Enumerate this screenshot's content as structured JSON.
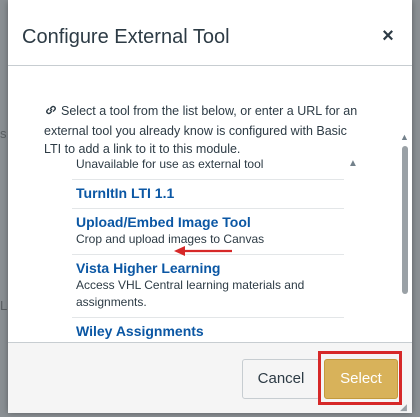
{
  "dialog": {
    "title": "Configure External Tool",
    "close_glyph": "×"
  },
  "intro_text": "Select a tool from the list below, or enter a URL for an external tool you already know is configured with Basic LTI to add a link to it to this module.",
  "tools": [
    {
      "name": "",
      "description": "Unavailable for use as external tool"
    },
    {
      "name": "TurnItIn LTI 1.1",
      "description": ""
    },
    {
      "name": "Upload/Embed Image Tool",
      "description": "Crop and upload images to Canvas"
    },
    {
      "name": "Vista Higher Learning",
      "description": "Access VHL Central learning materials and assignments."
    },
    {
      "name": "Wiley Assignments",
      "description": ""
    }
  ],
  "footer": {
    "cancel_label": "Cancel",
    "select_label": "Select"
  },
  "backdrop": {
    "fragment_a": "s t",
    "fragment_b": "L"
  },
  "colors": {
    "link_blue": "#0b57a4",
    "select_gold": "#d8b25a",
    "annotation_red": "#d62828"
  },
  "icons": {
    "link": "link-icon",
    "search": "search-icon",
    "close": "close-icon"
  }
}
